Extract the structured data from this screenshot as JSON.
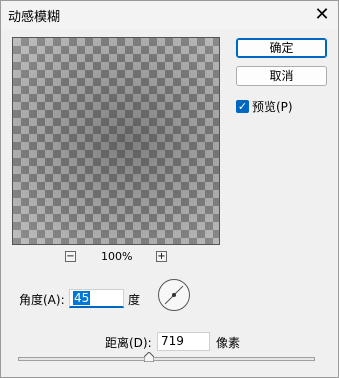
{
  "window": {
    "title": "动感模糊",
    "close_icon": "close-icon"
  },
  "preview": {
    "zoom_out_symbol": "−",
    "zoom_in_symbol": "+",
    "zoom_level": "100%"
  },
  "buttons": {
    "ok": "确定",
    "cancel": "取消"
  },
  "preview_checkbox": {
    "label": "预览(P)",
    "checked": true
  },
  "angle": {
    "label": "角度(A):",
    "value": "45",
    "unit": "度"
  },
  "distance": {
    "label": "距离(D):",
    "value": "719",
    "unit": "像素",
    "slider_fraction": 0.44
  },
  "colors": {
    "accent": "#0067c0",
    "selection": "#0078d7"
  }
}
